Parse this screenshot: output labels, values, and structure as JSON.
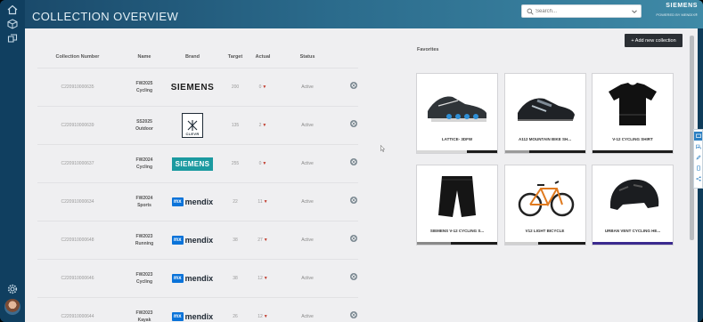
{
  "header": {
    "title": "COLLECTION OVERVIEW",
    "search_placeholder": "Search...",
    "brand_name": "SIEMENS",
    "brand_powered": "POWERED BY MENDIX®"
  },
  "table": {
    "headers": {
      "number": "Collection Number",
      "name": "Name",
      "brand": "Brand",
      "target": "Target",
      "actual": "Actual",
      "status": "Status"
    },
    "rows": [
      {
        "number": "C220910000635",
        "name_line1": "FW2025",
        "name_line2": "Cycling",
        "brand": "SIEMENS",
        "brand_style": "siemens-text",
        "target": "200",
        "actual": "0",
        "status": "Active"
      },
      {
        "number": "C220910000639",
        "name_line1": "SS2025",
        "name_line2": "Outdoor",
        "brand": "CLEVR",
        "brand_style": "clevr",
        "target": "135",
        "actual": "2",
        "status": "Active"
      },
      {
        "number": "C220910000637",
        "name_line1": "FW2024",
        "name_line2": "Cycling",
        "brand": "SIEMENS",
        "brand_style": "siemens-teal",
        "target": "255",
        "actual": "0",
        "status": "Active"
      },
      {
        "number": "C220910000634",
        "name_line1": "FW2024",
        "name_line2": "Sports",
        "brand": "mendix",
        "brand_style": "mendix",
        "target": "22",
        "actual": "11",
        "status": "Active"
      },
      {
        "number": "C220910000648",
        "name_line1": "FW2023",
        "name_line2": "Running",
        "brand": "mendix",
        "brand_style": "mendix",
        "target": "38",
        "actual": "27",
        "status": "Active"
      },
      {
        "number": "C220910000646",
        "name_line1": "FW2023",
        "name_line2": "Cycling",
        "brand": "mendix",
        "brand_style": "mendix",
        "target": "38",
        "actual": "12",
        "status": "Active"
      },
      {
        "number": "C220910000644",
        "name_line1": "FW2023",
        "name_line2": "Kayak",
        "brand": "mendix",
        "brand_style": "mendix",
        "target": "26",
        "actual": "12",
        "status": "Active"
      }
    ]
  },
  "mendix_prefix": "mx",
  "add_button_label": "+ Add new collection",
  "favorites": {
    "label": "Favorites",
    "items": [
      {
        "caption": "LATTICE- 3DFW",
        "icon": "sneaker-icon",
        "progress": 0.62,
        "bar_color": "#d8d8d8"
      },
      {
        "caption": "A112 MOUNTAIN BIKE SH...",
        "icon": "bike-shoe-icon",
        "progress": 0.3,
        "bar_color": "#9a9a9a"
      },
      {
        "caption": "V-12 CYCLING SHIRT",
        "icon": "shirt-icon",
        "progress": 0.0,
        "bar_color": "#1c1c1c"
      },
      {
        "caption": "SIEMENS V-12 CYCLING S...",
        "icon": "shorts-icon",
        "progress": 0.42,
        "bar_color": "#8a8a8a"
      },
      {
        "caption": "V12 LIGHT BICYCLE",
        "icon": "bicycle-icon",
        "progress": 0.42,
        "bar_color": "#d0d0d0"
      },
      {
        "caption": "URBAN VENT CYCLING HE...",
        "icon": "helmet-icon",
        "progress": 1.0,
        "bar_color": "#3b2a8f"
      }
    ]
  }
}
